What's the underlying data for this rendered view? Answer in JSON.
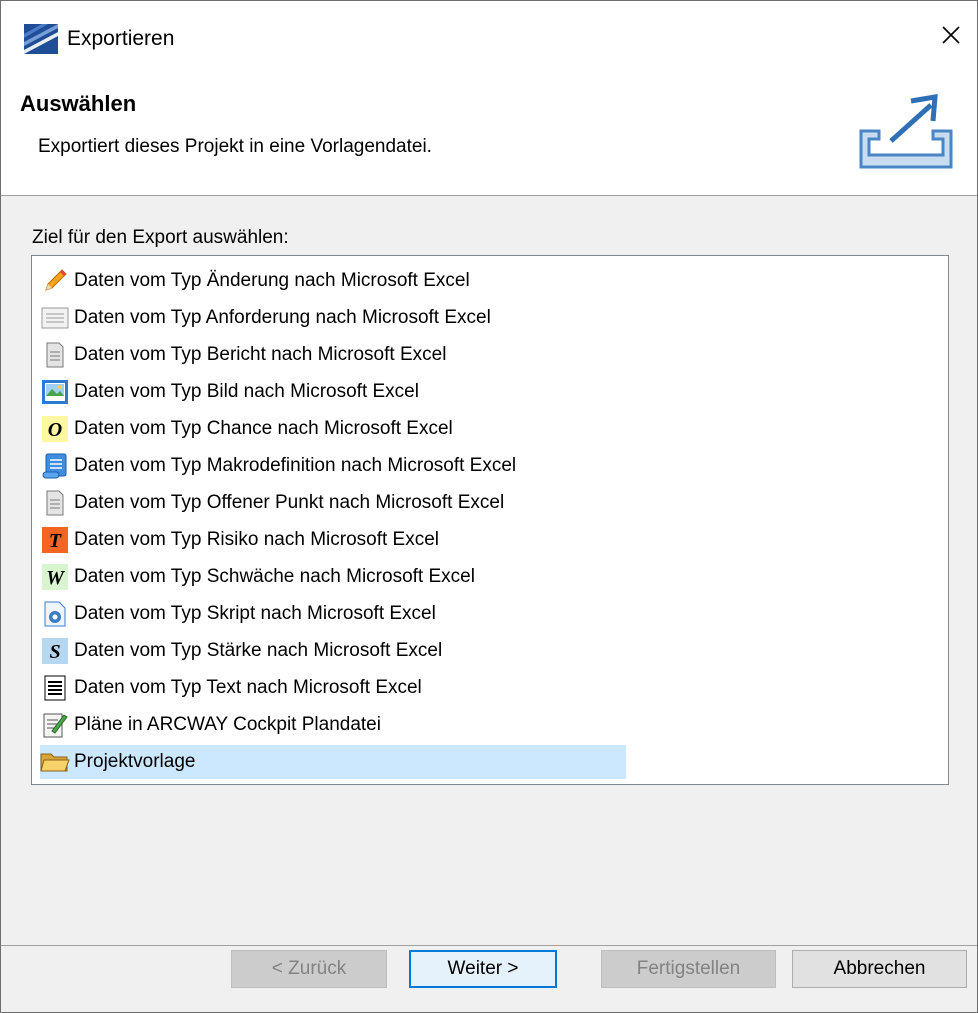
{
  "window": {
    "title": "Exportieren",
    "close_glyph": "✕"
  },
  "header": {
    "title": "Auswählen",
    "description": "Exportiert dieses Projekt in eine Vorlagendatei.",
    "icon": "export-icon"
  },
  "list": {
    "label": "Ziel für den Export auswählen:",
    "selected_index": 13,
    "items": [
      {
        "label": "Daten vom Typ Änderung nach Microsoft Excel",
        "icon": "pencil-icon"
      },
      {
        "label": "Daten vom Typ Anforderung nach Microsoft Excel",
        "icon": "requirement-icon"
      },
      {
        "label": "Daten vom Typ Bericht nach Microsoft Excel",
        "icon": "report-icon"
      },
      {
        "label": "Daten vom Typ Bild nach Microsoft Excel",
        "icon": "image-icon"
      },
      {
        "label": "Daten vom Typ Chance nach Microsoft Excel",
        "icon": "chance-o-icon"
      },
      {
        "label": "Daten vom Typ Makrodefinition nach Microsoft Excel",
        "icon": "macro-scroll-icon"
      },
      {
        "label": "Daten vom Typ Offener Punkt nach Microsoft Excel",
        "icon": "open-point-icon"
      },
      {
        "label": "Daten vom Typ Risiko nach Microsoft Excel",
        "icon": "risk-t-icon"
      },
      {
        "label": "Daten vom Typ Schwäche nach Microsoft Excel",
        "icon": "weakness-w-icon"
      },
      {
        "label": "Daten vom Typ Skript nach Microsoft Excel",
        "icon": "script-icon"
      },
      {
        "label": "Daten vom Typ Stärke nach Microsoft Excel",
        "icon": "strength-s-icon"
      },
      {
        "label": "Daten vom Typ Text nach Microsoft Excel",
        "icon": "text-icon"
      },
      {
        "label": "Pläne in ARCWAY Cockpit Plandatei",
        "icon": "plan-icon"
      },
      {
        "label": "Projektvorlage",
        "icon": "folder-icon"
      }
    ]
  },
  "buttons": {
    "back": "< Zurück",
    "next": "Weiter >",
    "finish": "Fertigstellen",
    "cancel": "Abbrechen"
  },
  "colors": {
    "accent": "#0078d7",
    "selection": "#cce8ff",
    "risk": "#f26522",
    "chance": "#fff7a1",
    "strength": "#b7d7f0",
    "weakness": "#d9f5d0"
  }
}
